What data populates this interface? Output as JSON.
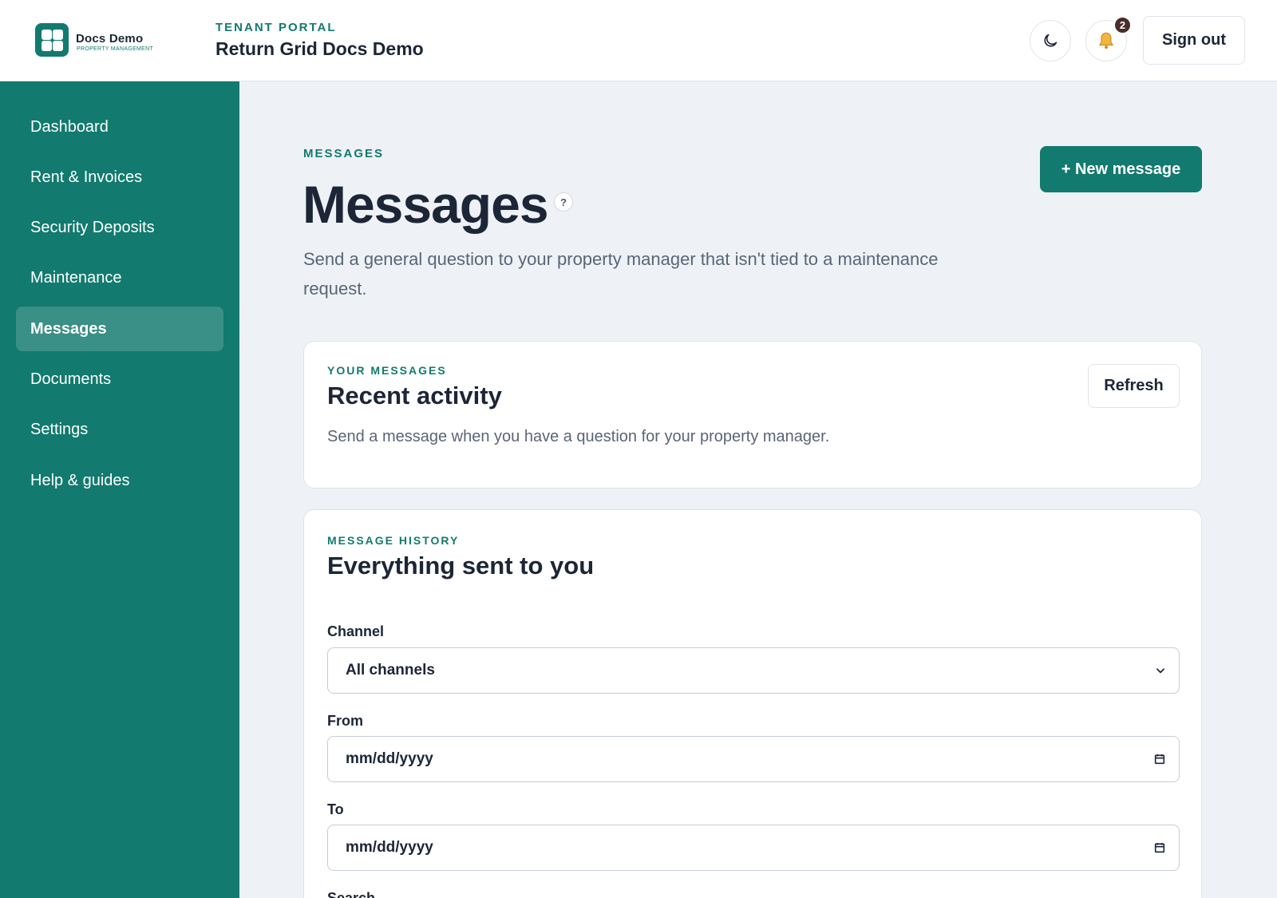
{
  "brand": {
    "name": "Docs Demo",
    "subtitle": "PROPERTY MANAGEMENT"
  },
  "header": {
    "portal_label": "TENANT PORTAL",
    "portal_title": "Return Grid Docs Demo",
    "notification_count": "2",
    "sign_out_label": "Sign out",
    "icons": {
      "theme": "moon-icon",
      "notifications": "bell-icon"
    }
  },
  "sidebar": {
    "items": [
      {
        "label": "Dashboard"
      },
      {
        "label": "Rent & Invoices"
      },
      {
        "label": "Security Deposits"
      },
      {
        "label": "Maintenance"
      },
      {
        "label": "Messages",
        "active": true
      },
      {
        "label": "Documents"
      },
      {
        "label": "Settings"
      },
      {
        "label": "Help & guides"
      }
    ]
  },
  "page": {
    "eyebrow": "MESSAGES",
    "title": "Messages",
    "help_glyph": "?",
    "description": "Send a general question to your property manager that isn't tied to a maintenance request.",
    "new_message_label": "+ New message"
  },
  "recent": {
    "eyebrow": "YOUR MESSAGES",
    "title": "Recent activity",
    "description": "Send a message when you have a question for your property manager.",
    "refresh_label": "Refresh"
  },
  "history": {
    "eyebrow": "MESSAGE HISTORY",
    "title": "Everything sent to you",
    "channel_label": "Channel",
    "channel_value": "All channels",
    "from_label": "From",
    "from_value": "mm/dd/yyyy",
    "to_label": "To",
    "to_value": "mm/dd/yyyy",
    "search_label": "Search"
  },
  "colors": {
    "accent": "#127a6e",
    "sidebar_active": "#3a8f86",
    "badge": "#4a2c2a",
    "background": "#eef2f6"
  }
}
